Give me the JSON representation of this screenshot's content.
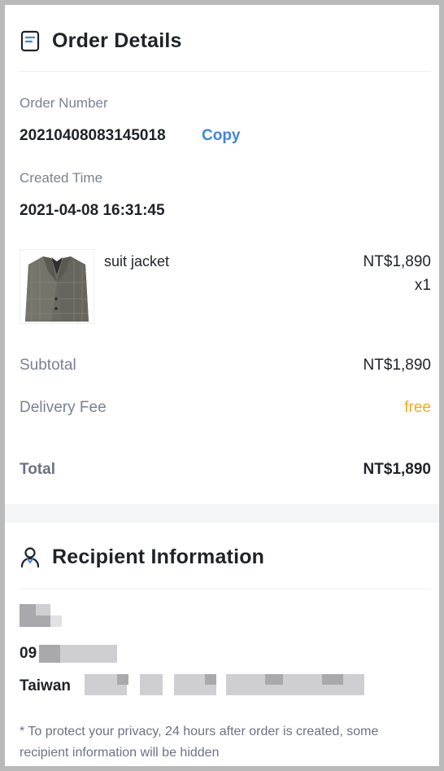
{
  "order_details": {
    "title": "Order Details",
    "icon": "document-icon",
    "order_number_label": "Order Number",
    "order_number": "20210408083145018",
    "copy_label": "Copy",
    "created_time_label": "Created Time",
    "created_time": "2021-04-08 16:31:45",
    "item": {
      "name": "suit jacket",
      "price": "NT$1,890",
      "quantity": "x1",
      "image": "suit-jacket-image"
    },
    "subtotal_label": "Subtotal",
    "subtotal": "NT$1,890",
    "delivery_fee_label": "Delivery Fee",
    "delivery_fee": "free",
    "total_label": "Total",
    "total": "NT$1,890"
  },
  "recipient": {
    "title": "Recipient Information",
    "icon": "person-icon",
    "phone_prefix": "09",
    "country": "Taiwan",
    "privacy_note": "* To protect your privacy, 24 hours after order is created, some recipient information will be hidden"
  },
  "colors": {
    "link": "#3e86dc",
    "free": "#f2a91d",
    "label": "#7a8190",
    "text": "#1f2329"
  }
}
